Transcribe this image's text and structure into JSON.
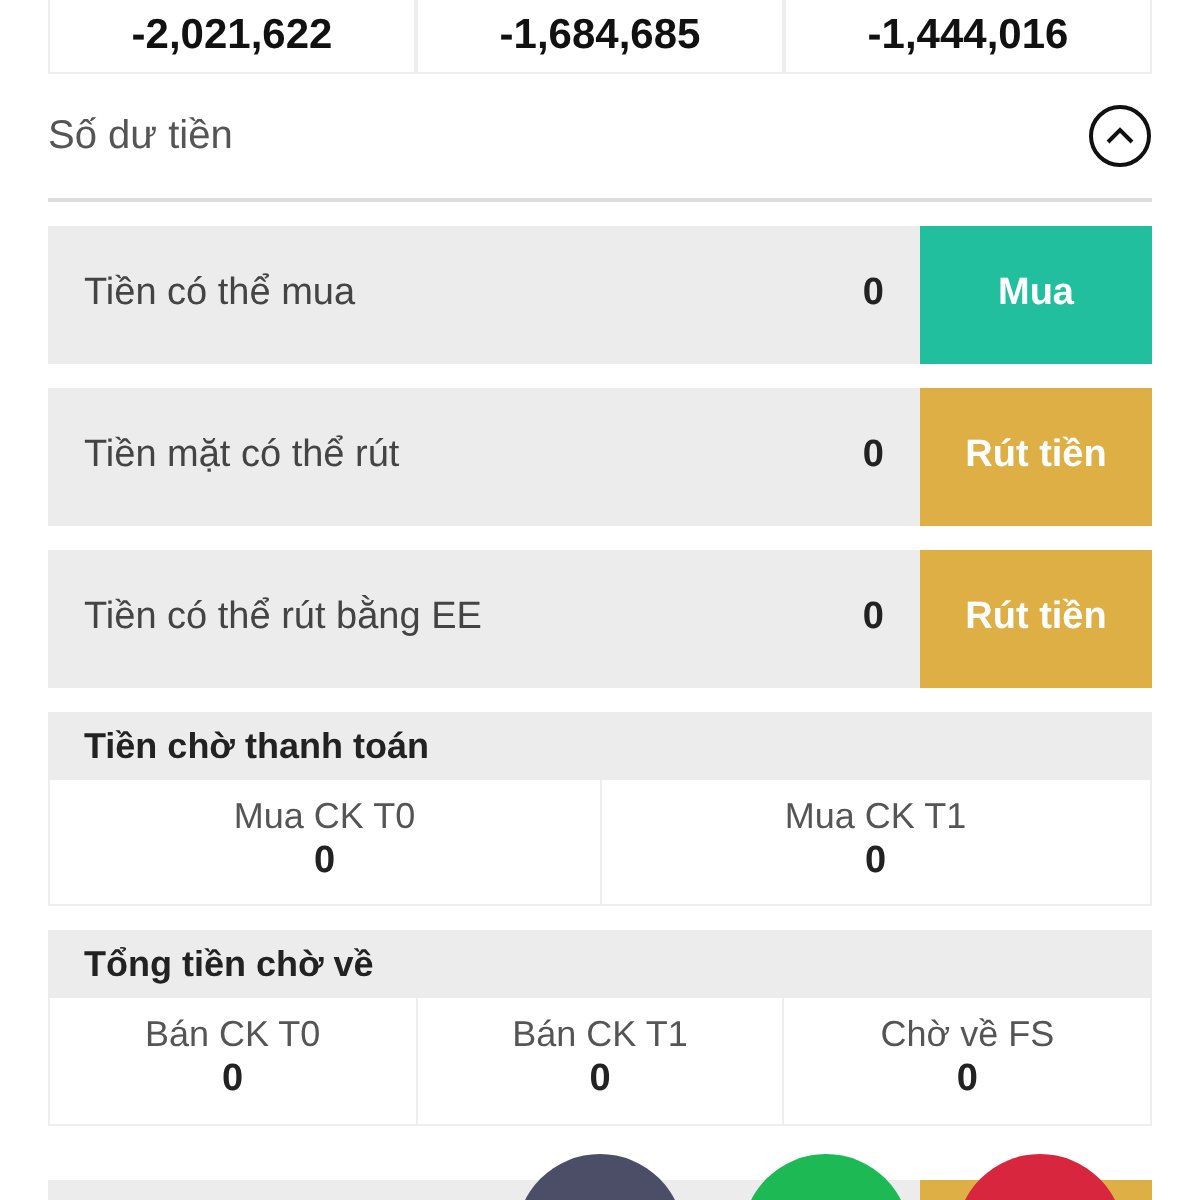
{
  "summary_values": [
    "-2,021,622",
    "-1,684,685",
    "-1,444,016"
  ],
  "cash_balance": {
    "title": "Số dư tiền",
    "expanded": true,
    "rows": [
      {
        "label": "Tiền có thể mua",
        "value": "0",
        "action": "Mua",
        "kind": "buy"
      },
      {
        "label": "Tiền mặt có thể rút",
        "value": "0",
        "action": "Rút tiền",
        "kind": "withdraw"
      },
      {
        "label": "Tiền có thể rút bằng EE",
        "value": "0",
        "action": "Rút tiền",
        "kind": "withdraw"
      }
    ],
    "groups": [
      {
        "title": "Tiền chờ thanh toán",
        "items": [
          {
            "label": "Mua CK T0",
            "value": "0"
          },
          {
            "label": "Mua CK T1",
            "value": "0"
          }
        ]
      },
      {
        "title": "Tổng tiền chờ về",
        "items": [
          {
            "label": "Bán CK T0",
            "value": "0"
          },
          {
            "label": "Bán CK T1",
            "value": "0"
          },
          {
            "label": "Chờ về FS",
            "value": "0"
          }
        ]
      }
    ]
  },
  "floating_buttons": [
    {
      "color": "#4b4e66"
    },
    {
      "color": "#1db954"
    },
    {
      "color": "#d7263d"
    }
  ]
}
